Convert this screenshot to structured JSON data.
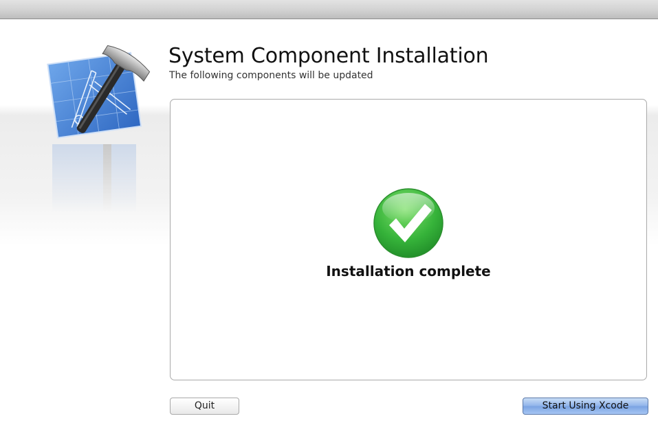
{
  "window": {
    "heading": "System Component Installation",
    "subheading": "The following components will be updated"
  },
  "app_icon": {
    "name": "xcode-hammer-blueprint-icon"
  },
  "panel": {
    "status_icon": "checkmark-icon",
    "status_text": "Installation complete"
  },
  "buttons": {
    "quit_label": "Quit",
    "start_label": "Start Using Xcode"
  },
  "colors": {
    "success_green": "#3dbb3d",
    "blueprint_blue": "#3f7fd6",
    "default_button_blue": "#8fb3ea"
  }
}
